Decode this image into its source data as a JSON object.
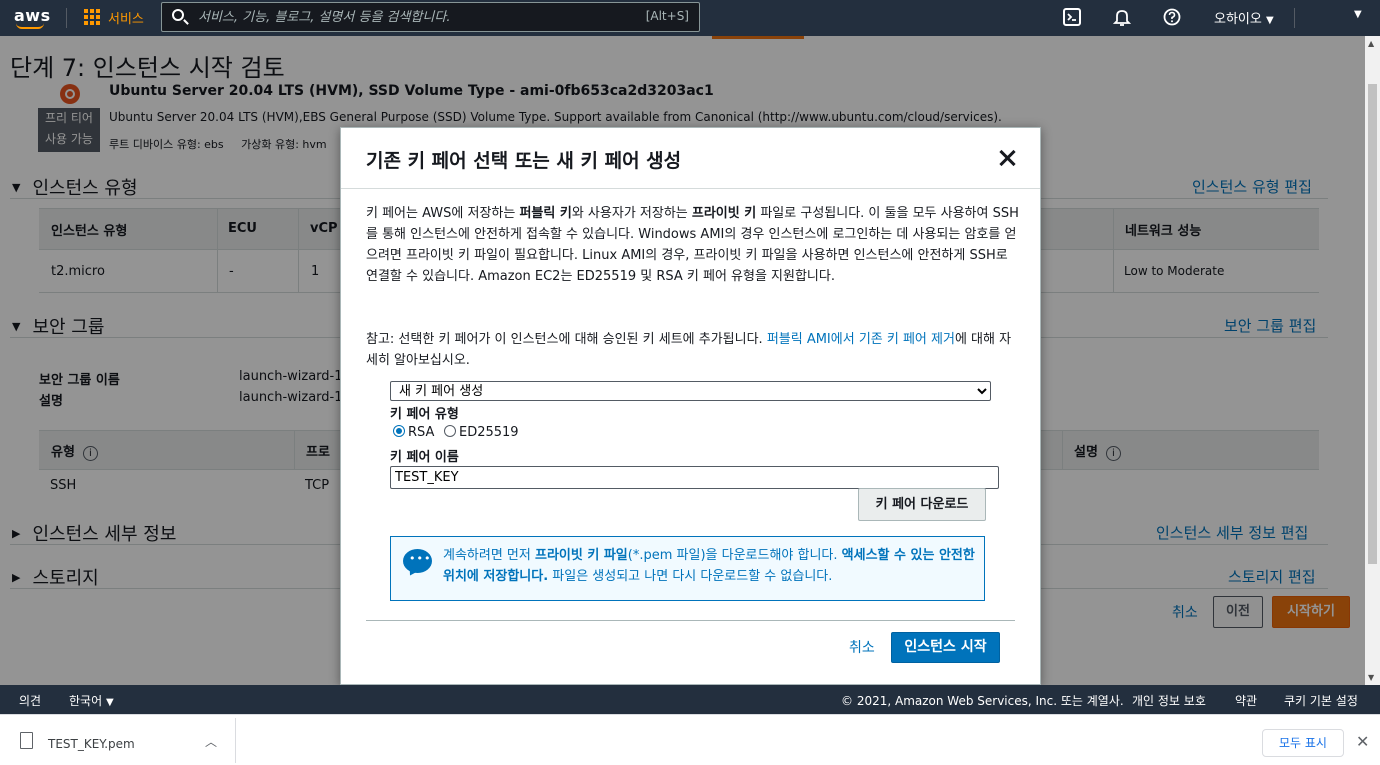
{
  "topnav": {
    "logo": "aws",
    "services_label": "서비스",
    "search_placeholder": "서비스, 기능, 블로그, 설명서 등을 검색합니다.",
    "search_shortcut": "[Alt+S]",
    "region_label": "오하이오",
    "icons": [
      "cloudshell-icon",
      "bell-icon",
      "help-icon",
      "account-caret-icon"
    ]
  },
  "page": {
    "title": "단계 7: 인스턴스 시작 검토",
    "ami": {
      "name": "Ubuntu Server 20.04 LTS (HVM), SSD Volume Type - ami-0fb653ca2d3203ac1",
      "description": "Ubuntu Server 20.04 LTS (HVM),EBS General Purpose (SSD) Volume Type. Support available from Canonical (http://www.ubuntu.com/cloud/services).",
      "free_tier_line1": "프리 티어",
      "free_tier_line2": "사용 가능",
      "root_device": "루트 디바이스 유형: ebs",
      "virtualization": "가상화 유형: hvm"
    },
    "instance_type_section": {
      "title": "인스턴스 유형",
      "edit_link": "인스턴스 유형 편집",
      "columns": [
        "인스턴스 유형",
        "ECU",
        "vCP",
        "네트워크 성능"
      ],
      "row": [
        "t2.micro",
        "-",
        "1",
        "Low to Moderate"
      ]
    },
    "security_group_section": {
      "title": "보안 그룹",
      "edit_link": "보안 그룹 편집",
      "name_label": "보안 그룹 이름",
      "name_value": "launch-wizard-1",
      "desc_label": "설명",
      "desc_value": "launch-wizard-1",
      "columns": [
        "유형",
        "프로",
        "설명"
      ],
      "row": [
        "SSH",
        "TCP"
      ]
    },
    "instance_details_section": {
      "title": "인스턴스 세부 정보",
      "edit_link": "인스턴스 세부 정보 편집"
    },
    "storage_section": {
      "title": "스토리지",
      "edit_link": "스토리지 편집"
    },
    "actions": {
      "cancel": "취소",
      "previous": "이전",
      "launch": "시작하기"
    }
  },
  "modal": {
    "title": "기존 키 페어 선택 또는 새 키 페어 생성",
    "para1_parts": [
      "키 페어는 AWS에 저장하는 ",
      "퍼블릭 키",
      "와 사용자가 저장하는 ",
      "프라이빗 키",
      " 파일로 구성됩니다. 이 둘을 모두 사용하여 SSH를 통해 인스턴스에 안전하게 접속할 수 있습니다. Windows AMI의 경우 인스턴스에 로그인하는 데 사용되는 암호를 얻으려면 프라이빗 키 파일이 필요합니다. Linux AMI의 경우, 프라이빗 키 파일을 사용하면 인스턴스에 안전하게 SSH로 연결할 수 있습니다. Amazon EC2는 ED25519 및 RSA 키 페어 유형을 지원합니다."
    ],
    "para2_prefix": "참고: 선택한 키 페어가 이 인스턴스에 대해 승인된 키 세트에 추가됩니다. ",
    "para2_link": "퍼블릭 AMI에서 기존 키 페어 제거",
    "para2_suffix": "에 대해 자세히 알아보십시오.",
    "select_value": "새 키 페어 생성",
    "key_type_label": "키 페어 유형",
    "radio_rsa": "RSA",
    "radio_ed": "ED25519",
    "key_name_label": "키 페어 이름",
    "key_name_value": "TEST_KEY",
    "download_button": "키 페어 다운로드",
    "alert_parts": [
      "계속하려면 먼저 ",
      "프라이빗 키 파일",
      "(*.pem 파일)을 다운로드해야 합니다. ",
      "액세스할 수 있는 안전한 위치에 저장합니다.",
      " 파일은 생성되고 나면 다시 다운로드할 수 없습니다."
    ],
    "cancel": "취소",
    "launch": "인스턴스 시작"
  },
  "footer": {
    "feedback": "의견",
    "language": "한국어",
    "copyright": "© 2021, Amazon Web Services, Inc. 또는 계열사.",
    "privacy": "개인 정보 보호",
    "terms": "약관",
    "cookies": "쿠키 기본 설정"
  },
  "download_bar": {
    "file_name": "TEST_KEY.pem",
    "show_all": "모두 표시"
  }
}
